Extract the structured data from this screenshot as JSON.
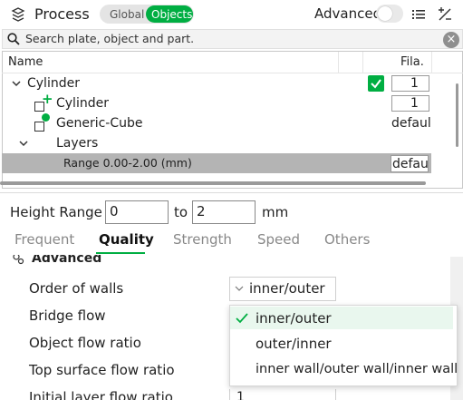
{
  "header": {
    "title": "Process",
    "toggle_global": "Global",
    "toggle_objects": "Objects",
    "advanced_label": "Advanced"
  },
  "search": {
    "placeholder": "Search plate, object and part."
  },
  "table": {
    "col_name": "Name",
    "col_fila": "Fila.",
    "rows": [
      {
        "name": "Cylinder",
        "value": "1"
      },
      {
        "name": "Cylinder",
        "value": "1"
      },
      {
        "name": "Generic-Cube",
        "value": "default"
      },
      {
        "name": "Layers",
        "value": ""
      },
      {
        "name": "Range 0.00-2.00 (mm)",
        "value": "default"
      }
    ]
  },
  "height_range": {
    "label": "Height Range",
    "from": "0",
    "to_label": "to",
    "to": "2",
    "unit": "mm"
  },
  "tabs": [
    "Frequent",
    "Quality",
    "Strength",
    "Speed",
    "Others"
  ],
  "section": {
    "title": "Advanced"
  },
  "settings": [
    {
      "label": "Order of walls",
      "value": "inner/outer"
    },
    {
      "label": "Bridge flow",
      "value": ""
    },
    {
      "label": "Object flow ratio",
      "value": ""
    },
    {
      "label": "Top surface flow ratio",
      "value": ""
    },
    {
      "label": "Initial layer flow ratio",
      "value": "1"
    }
  ],
  "dropdown": {
    "options": [
      "inner/outer",
      "outer/inner",
      "inner wall/outer wall/inner wall"
    ],
    "selected": "inner/outer"
  },
  "colors": {
    "accent": "#00ae42"
  }
}
